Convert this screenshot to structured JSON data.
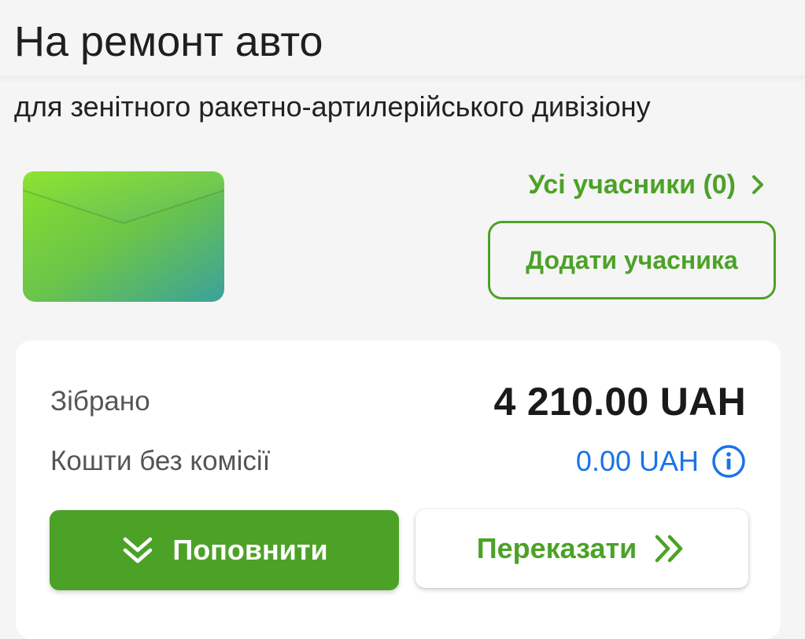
{
  "header": {
    "title": "На ремонт авто"
  },
  "jar": {
    "description": "для зенітного ракетно-артилерійського дивізіону",
    "cover_icon": "envelope-icon",
    "participants_label": "Усі учасники (0)",
    "add_participant_label": "Додати учасника"
  },
  "summary": {
    "collected_label": "Зібрано",
    "collected_value": "4 210.00 UAH",
    "fee_free_label": "Кошти без комісії",
    "fee_free_value": "0.00 UAH"
  },
  "actions": {
    "top_up_label": "Поповнити",
    "transfer_label": "Переказати"
  },
  "colors": {
    "accent_green": "#4ca227",
    "link_blue": "#1a73e8",
    "background": "#f5f5f5",
    "card": "#ffffff"
  }
}
